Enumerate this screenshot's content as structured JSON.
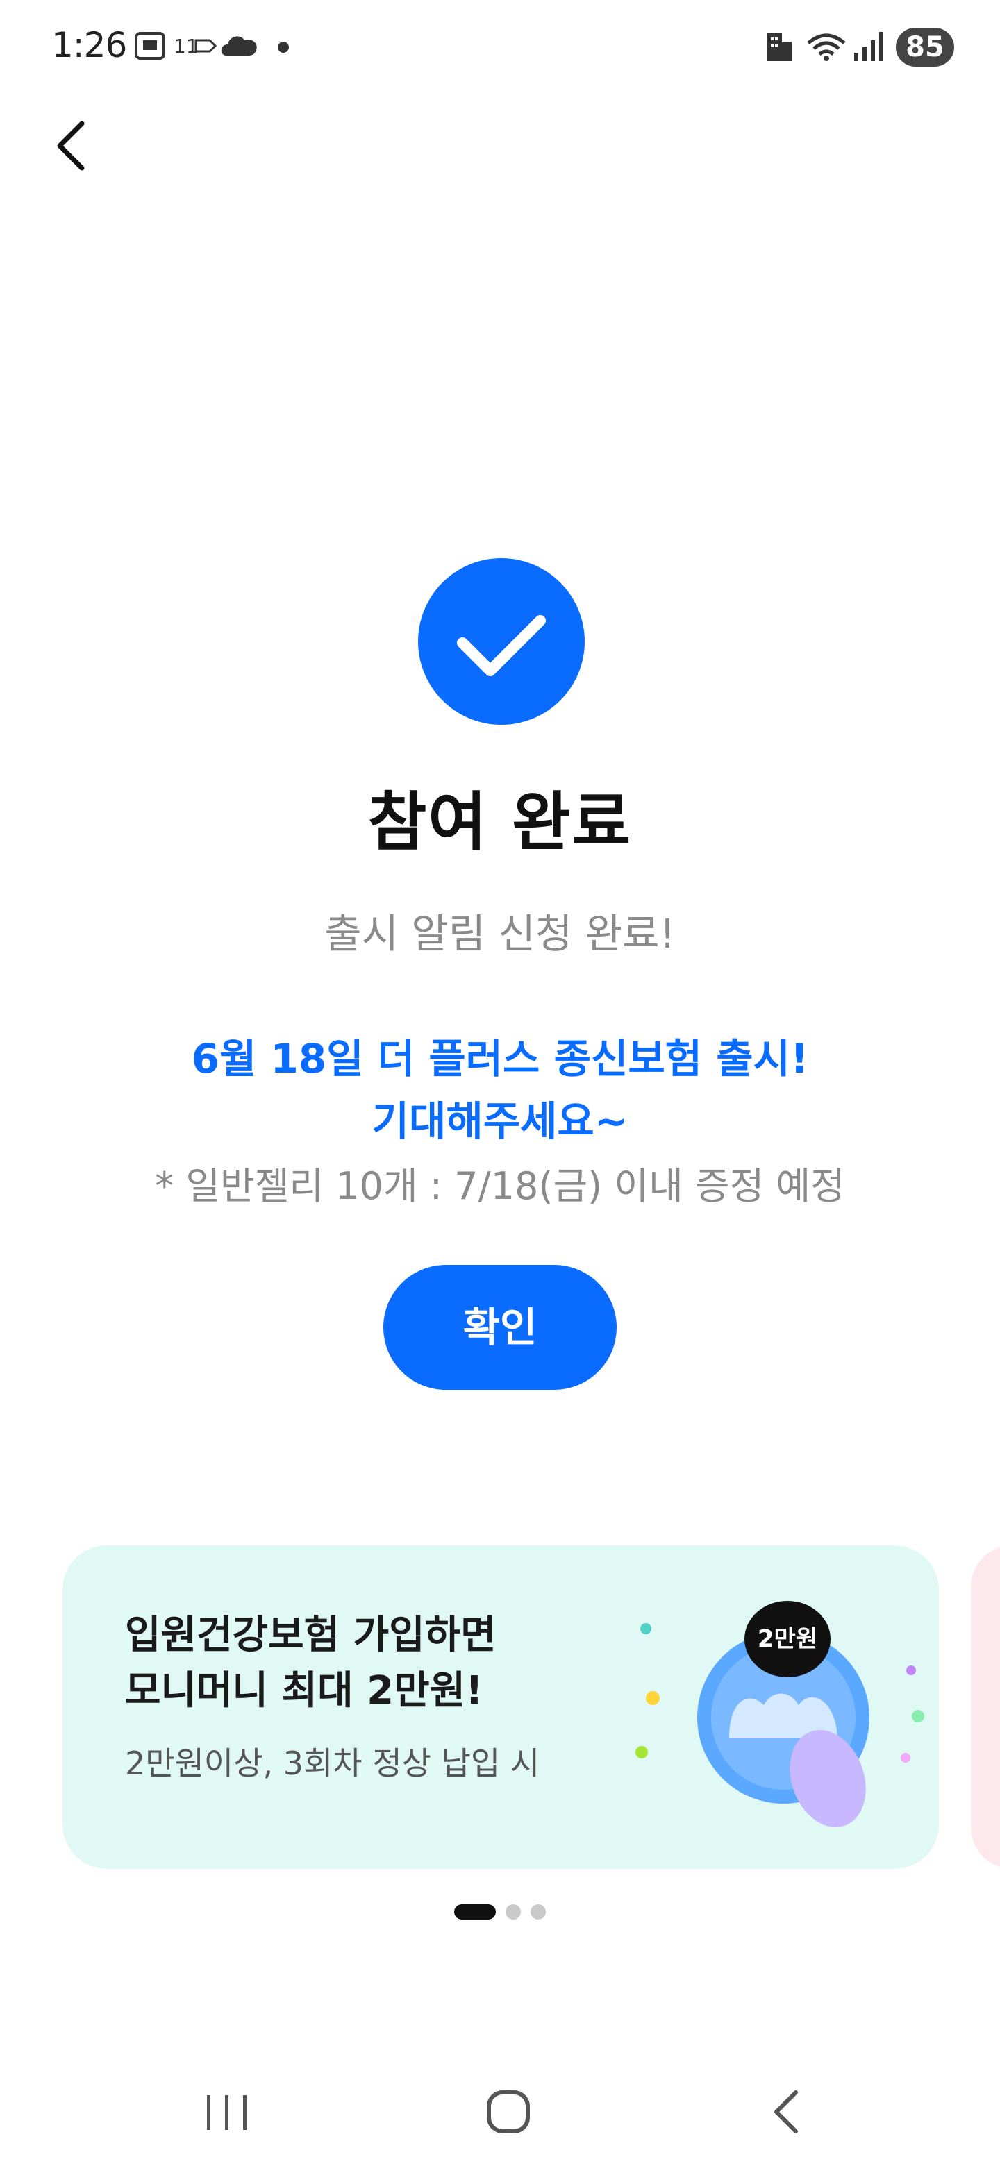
{
  "status_bar": {
    "time": "1:26",
    "battery": "85",
    "icons": [
      "screenshot-icon",
      "network-11-icon",
      "cloud-icon",
      "dot-icon",
      "building-icon",
      "wifi-icon",
      "signal-icon"
    ]
  },
  "header": {
    "back_icon": "chevron-left-icon"
  },
  "result": {
    "check_icon": "check-icon",
    "title": "참여 완료",
    "subtitle": "출시 알림 신청 완료!",
    "highlight_line1": "6월 18일 더 플러스 종신보험 출시!",
    "highlight_line2": "기대해주세요~",
    "note": "* 일반젤리 10개 : 7/18(금) 이내 증정 예정",
    "confirm_label": "확인"
  },
  "banner": {
    "title_line1": "입원건강보험 가입하면",
    "title_line2": "모니머니 최대 2만원!",
    "subtitle": "2만원이상, 3회차 정상 납입 시",
    "badge": "2만원",
    "background_color": "#e1f9f5"
  },
  "carousel": {
    "pages": 3,
    "active_index": 0
  },
  "colors": {
    "accent": "#0a6bff"
  }
}
